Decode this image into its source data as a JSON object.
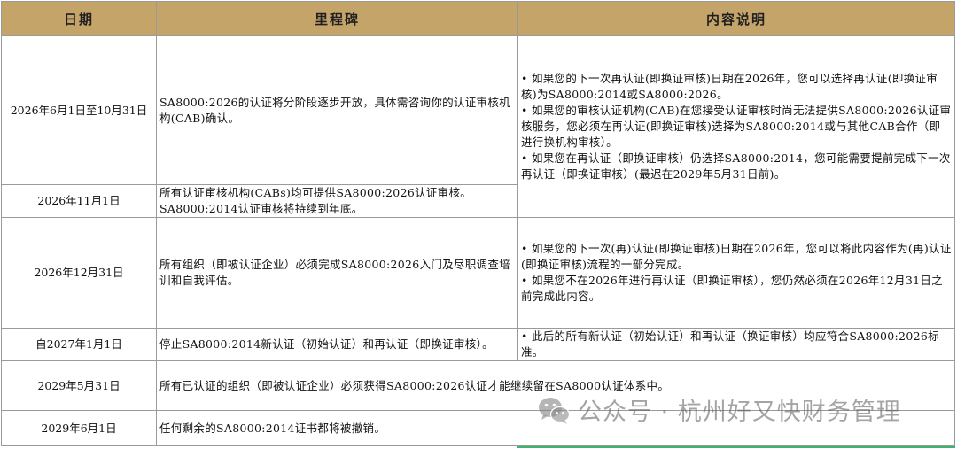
{
  "headers": {
    "date": "日期",
    "milestone": "里程碑",
    "details": "内容说明"
  },
  "rows": [
    {
      "date": "2026年6月1日至10月31日",
      "milestone": "SA8000:2026的认证将分阶段逐步开放，具体需咨询你的认证审核机构(CAB)确认。",
      "details": [
        "• 如果您的下一次再认证(即换证审核)日期在2026年，您可以选择再认证(即换证审核)为SA8000:2014或SA8000:2026。",
        "• 如果您的审核认证机构(CAB)在您接受认证审核时尚无法提供SA8000:2026认证审核服务，您必须在再认证(即换证审核)选择为SA8000:2014或与其他CAB合作（即进行换机构审核）。",
        "• 如果您在再认证（即换证审核）仍选择SA8000:2014，您可能需要提前完成下一次再认证（即换证审核）(最迟在2029年5月31日前)。"
      ]
    },
    {
      "date": "2026年11月1日",
      "milestone": "所有认证审核机构(CABs)均可提供SA8000:2026认证审核。SA8000:2014认证审核将持续到年底。"
    },
    {
      "date": "2026年12月31日",
      "milestone": "所有组织（即被认证企业）必须完成SA8000:2026入门及尽职调查培训和自我评估。",
      "details": [
        "• 如果您的下一次(再)认证(即换证审核)日期在2026年，您可以将此内容作为(再)认证(即换证审核)流程的一部分完成。",
        "• 如果您不在2026年进行再认证（即换证审核），您仍然必须在2026年12月31日之前完成此内容。"
      ]
    },
    {
      "date": "自2027年1月1日",
      "milestone": "停止SA8000:2014新认证（初始认证）和再认证（即换证审核）。",
      "details": [
        "• 此后的所有新认证（初始认证）和再认证（换证审核）均应符合SA8000:2026标准。"
      ]
    },
    {
      "date": "2029年5月31日",
      "milestone": "所有已认证的组织（即被认证企业）必须获得SA8000:2026认证才能继续留在SA8000认证体系中。"
    },
    {
      "date": "2029年6月1日",
      "milestone": "任何剩余的SA8000:2014证书都将被撤销。"
    }
  ],
  "watermark": {
    "text": "公众号 · 杭州好又快财务管理",
    "icon": "wechat-icon"
  },
  "colors": {
    "header_bg": "#c5a46a",
    "border": "#9a9a9a",
    "accent_line": "#3cb371"
  }
}
